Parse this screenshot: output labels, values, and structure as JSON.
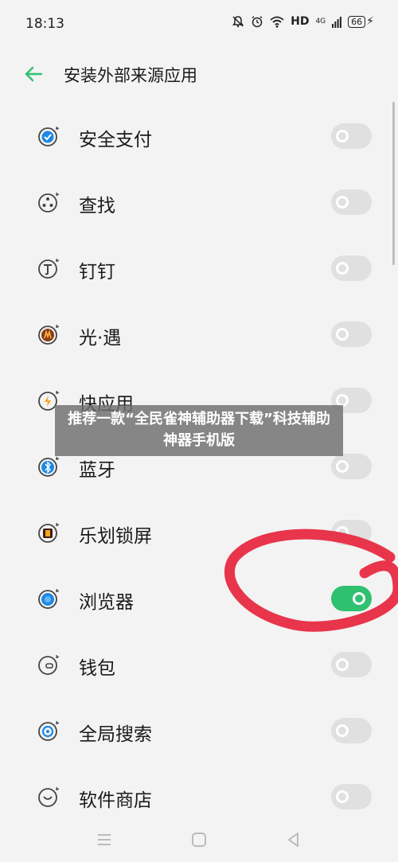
{
  "status": {
    "time": "18:13",
    "hd": "HD",
    "network": "4G",
    "battery": "66"
  },
  "header": {
    "title": "安装外部来源应用"
  },
  "apps": [
    {
      "label": "安全支付",
      "enabled": false,
      "icon": "security-payment-icon"
    },
    {
      "label": "查找",
      "enabled": false,
      "icon": "find-device-icon"
    },
    {
      "label": "钉钉",
      "enabled": false,
      "icon": "dingtalk-icon"
    },
    {
      "label": "光·遇",
      "enabled": false,
      "icon": "sky-game-icon"
    },
    {
      "label": "快应用",
      "enabled": false,
      "icon": "quick-app-icon"
    },
    {
      "label": "蓝牙",
      "enabled": false,
      "icon": "bluetooth-icon"
    },
    {
      "label": "乐划锁屏",
      "enabled": false,
      "icon": "lock-screen-icon"
    },
    {
      "label": "浏览器",
      "enabled": true,
      "icon": "browser-icon"
    },
    {
      "label": "钱包",
      "enabled": false,
      "icon": "wallet-icon"
    },
    {
      "label": "全局搜索",
      "enabled": false,
      "icon": "global-search-icon"
    },
    {
      "label": "软件商店",
      "enabled": false,
      "icon": "app-store-icon"
    }
  ],
  "overlay": {
    "text": "推荐一款“全民雀神辅助器下载”科技辅助神器手机版"
  },
  "colors": {
    "accent": "#2fc16f",
    "annotation": "#e8354b"
  }
}
